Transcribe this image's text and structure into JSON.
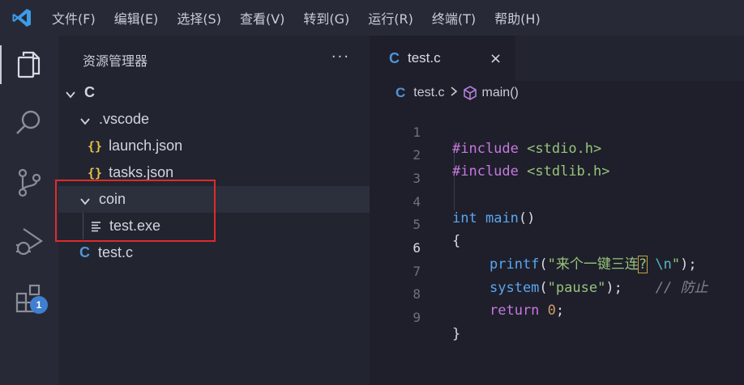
{
  "menubar": {
    "items": [
      "文件(F)",
      "编辑(E)",
      "选择(S)",
      "查看(V)",
      "转到(G)",
      "运行(R)",
      "终端(T)",
      "帮助(H)"
    ]
  },
  "activity_bar": {
    "icons": [
      "explorer-icon",
      "search-icon",
      "source-control-icon",
      "run-debug-icon",
      "extensions-icon"
    ],
    "extensions_badge": "1"
  },
  "sidebar": {
    "title": "资源管理器",
    "more": "···",
    "tree": [
      {
        "label": "C",
        "kind": "folder-root",
        "expanded": true
      },
      {
        "label": ".vscode",
        "kind": "folder",
        "expanded": true
      },
      {
        "label": "launch.json",
        "kind": "json",
        "icon_text": "{}"
      },
      {
        "label": "tasks.json",
        "kind": "json",
        "icon_text": "{}"
      },
      {
        "label": "coin",
        "kind": "folder",
        "expanded": true
      },
      {
        "label": "test.exe",
        "kind": "file"
      },
      {
        "label": "test.c",
        "kind": "c",
        "icon_text": "C"
      }
    ]
  },
  "editor": {
    "tab": {
      "icon_text": "C",
      "label": "test.c",
      "close": "×"
    },
    "breadcrumb": {
      "icon_text": "C",
      "file": "test.c",
      "symbol": "main()"
    },
    "line_numbers": [
      "1",
      "2",
      "3",
      "4",
      "5",
      "6",
      "7",
      "8",
      "9"
    ],
    "current_line": "6",
    "code": {
      "l1_directive": "#include",
      "l1_header": "<stdio.h>",
      "l2_directive": "#include",
      "l2_header": "<stdlib.h>",
      "l4_type": "int",
      "l4_name": "main",
      "l4_parens": "()",
      "l5": "{",
      "l6_fn": "printf",
      "l6_open": "(",
      "l6_str_a": "\"来个一键三连",
      "l6_str_q": "?",
      "l6_str_b": " ",
      "l6_esc_a": "\\n",
      "l6_quote": "\"",
      "l6_close": ");",
      "l7_fn": "system",
      "l7_open": "(",
      "l7_str": "\"pause\"",
      "l7_close": ");",
      "l7_comment": "// 防止",
      "l8_kw": "return",
      "l8_num": "0",
      "l8_semi": ";",
      "l9": "}"
    }
  }
}
